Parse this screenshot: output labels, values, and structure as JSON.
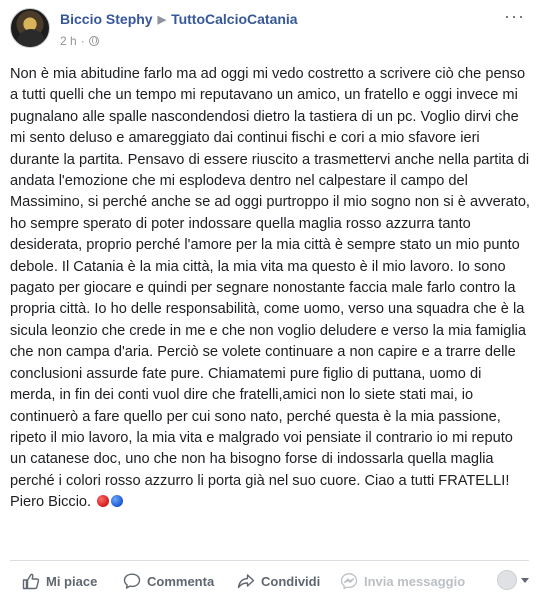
{
  "post": {
    "author": "Biccio Stephy",
    "target_page": "TuttoCalcioCatania",
    "timestamp": "2 h",
    "separator": "·",
    "more_label": "···",
    "body": "Non è mia abitudine farlo ma ad oggi mi vedo costretto a scrivere ciò che penso a tutti quelli che un tempo mi reputavano un amico, un fratello e oggi invece mi pugnalano alle spalle nascondendosi dietro la tastiera di un pc. Voglio dirvi che mi sento deluso e amareggiato dai continui fischi e cori a mio sfavore ieri durante la partita. Pensavo di essere riuscito a trasmettervi anche nella partita di andata l'emozione che mi esplodeva dentro nel calpestare il campo del Massimino, si perché anche se ad oggi purtroppo il mio sogno non si è avverato, ho sempre sperato di poter indossare quella maglia rosso azzurra tanto desiderata, proprio perché l'amore per la mia città è sempre stato un mio punto debole. Il Catania è la mia città, la mia vita ma questo è il mio lavoro. Io sono pagato per giocare e quindi per segnare nonostante faccia male farlo contro la propria città. Io ho delle responsabilità, come uomo, verso una squadra che è la sicula leonzio che crede in me e che non voglio deludere e verso la mia famiglia che non campa d'aria. Perciò se volete continuare a non capire e a trarre delle conclusioni assurde fate pure. Chiamatemi pure figlio di puttana, uomo di merda, in fin dei conti vuol dire che fratelli,amici non lo siete stati mai, io continuerò a fare quello per cui sono nato, perché questa è la mia passione, ripeto il mio lavoro, la mia vita e malgrado voi pensiate il contrario io mi reputo un catanese doc, uno che non ha bisogno forse di indossarla quella maglia perché i colori rosso azzurro li porta già nel suo cuore. Ciao a tutti FRATELLI!",
    "signature": "Piero Biccio."
  },
  "actions": {
    "like": "Mi piace",
    "comment": "Commenta",
    "share": "Condividi",
    "message": "Invia messaggio"
  },
  "colors": {
    "link": "#365899",
    "muted": "#90949c",
    "text": "#1c1e21",
    "ball_red": "#d11a1a",
    "ball_blue": "#1a56d1"
  },
  "icons": [
    "globe-icon",
    "more-icon",
    "like-icon",
    "comment-icon",
    "share-icon",
    "message-icon",
    "audience-caret-icon",
    "red-circle-emoji",
    "blue-circle-emoji"
  ]
}
